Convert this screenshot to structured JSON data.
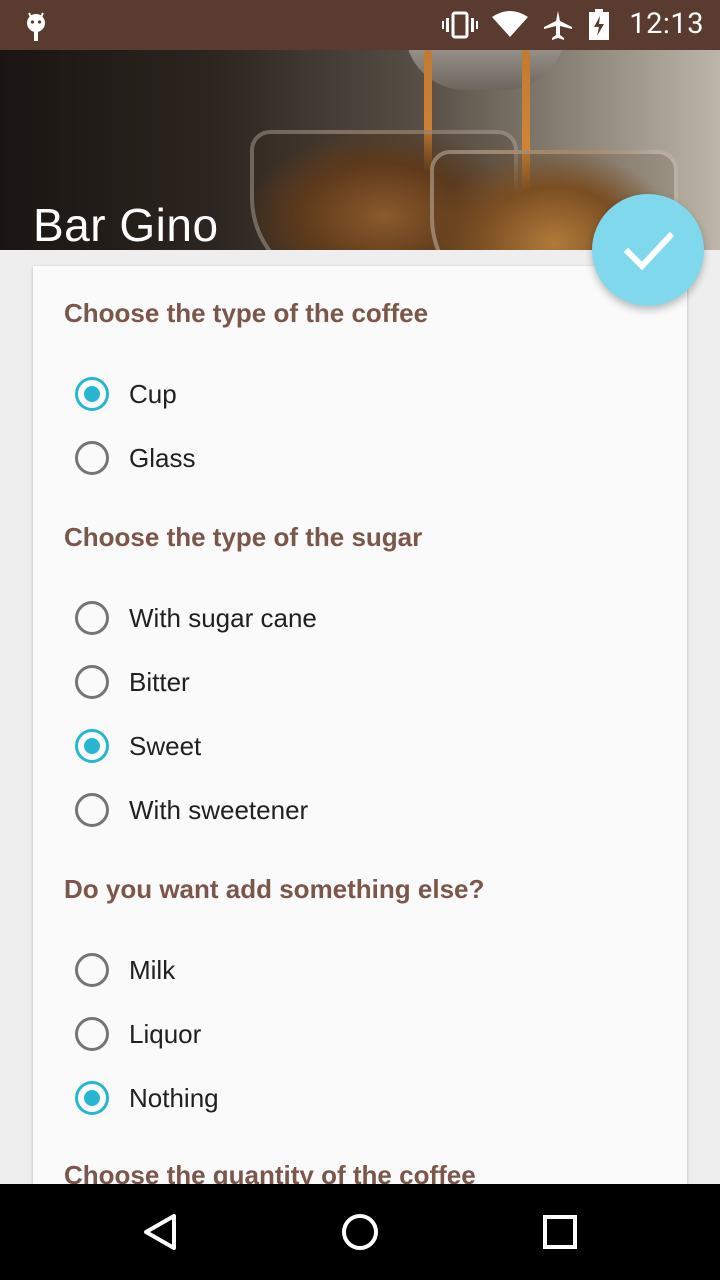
{
  "status_bar": {
    "time": "12:13",
    "icons": [
      "android-icon",
      "vibrate-icon",
      "wifi-icon",
      "airplane-icon",
      "battery-charging-icon"
    ]
  },
  "header": {
    "title": "Bar Gino"
  },
  "fab": {
    "icon": "check-icon",
    "color": "#80d8ec"
  },
  "form": {
    "sections": [
      {
        "title": "Choose the type of the coffee",
        "options": [
          {
            "label": "Cup",
            "checked": true
          },
          {
            "label": "Glass",
            "checked": false
          }
        ]
      },
      {
        "title": "Choose the type of the sugar",
        "options": [
          {
            "label": "With sugar cane",
            "checked": false
          },
          {
            "label": "Bitter",
            "checked": false
          },
          {
            "label": "Sweet",
            "checked": true
          },
          {
            "label": "With sweetener",
            "checked": false
          }
        ]
      },
      {
        "title": "Do you want add something else?",
        "options": [
          {
            "label": "Milk",
            "checked": false
          },
          {
            "label": "Liquor",
            "checked": false
          },
          {
            "label": "Nothing",
            "checked": true
          }
        ]
      },
      {
        "title": "Choose the quantity of the coffee",
        "options": []
      }
    ]
  },
  "colors": {
    "accent": "#26b6d2",
    "section_title": "#7a574a",
    "status_bar": "#5a3b30"
  },
  "nav_bar": {
    "icons": [
      "back-icon",
      "home-icon",
      "recents-icon"
    ]
  }
}
